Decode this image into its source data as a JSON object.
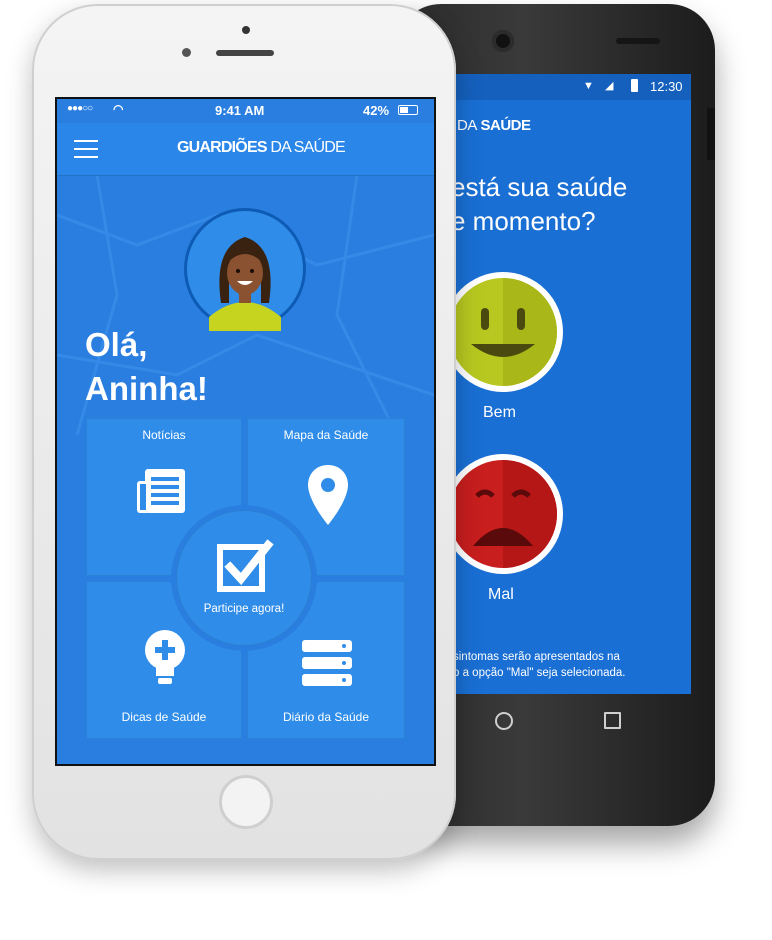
{
  "iphone": {
    "status": {
      "carrier_dots": "●●●○○",
      "time": "9:41 AM",
      "battery": "42%"
    },
    "header": {
      "title_main": "GUARDIÕES",
      "title_sub": "DA SAÚDE"
    },
    "greeting": {
      "line1": "Olá,",
      "line2": "Aninha!"
    },
    "tiles": {
      "news": "Notícias",
      "map": "Mapa da Saúde",
      "tips": "Dicas de Saúde",
      "diary": "Diário da Saúde",
      "participate": "Participe agora!"
    }
  },
  "android": {
    "status": {
      "time": "12:30"
    },
    "header": {
      "title_main": "DA",
      "title_sub": "SAÚDE"
    },
    "question": {
      "line1": "está sua saúde",
      "line2": "e momento?"
    },
    "options": {
      "good": "Bem",
      "bad": "Mal"
    },
    "note": {
      "line1": "sintomas serão apresentados na",
      "line2": "o a opção \"Mal\" seja selecionada."
    }
  },
  "colors": {
    "primary": "#2a86e8",
    "good_face": "#b8c820",
    "bad_face": "#c81e1e"
  },
  "icons": [
    "menu-icon",
    "wifi-icon",
    "battery-icon",
    "newspaper-icon",
    "map-pin-icon",
    "checkbox-icon",
    "lightbulb-plus-icon",
    "list-icon",
    "home-button-icon",
    "back-icon",
    "square-icon",
    "signal-icon"
  ]
}
